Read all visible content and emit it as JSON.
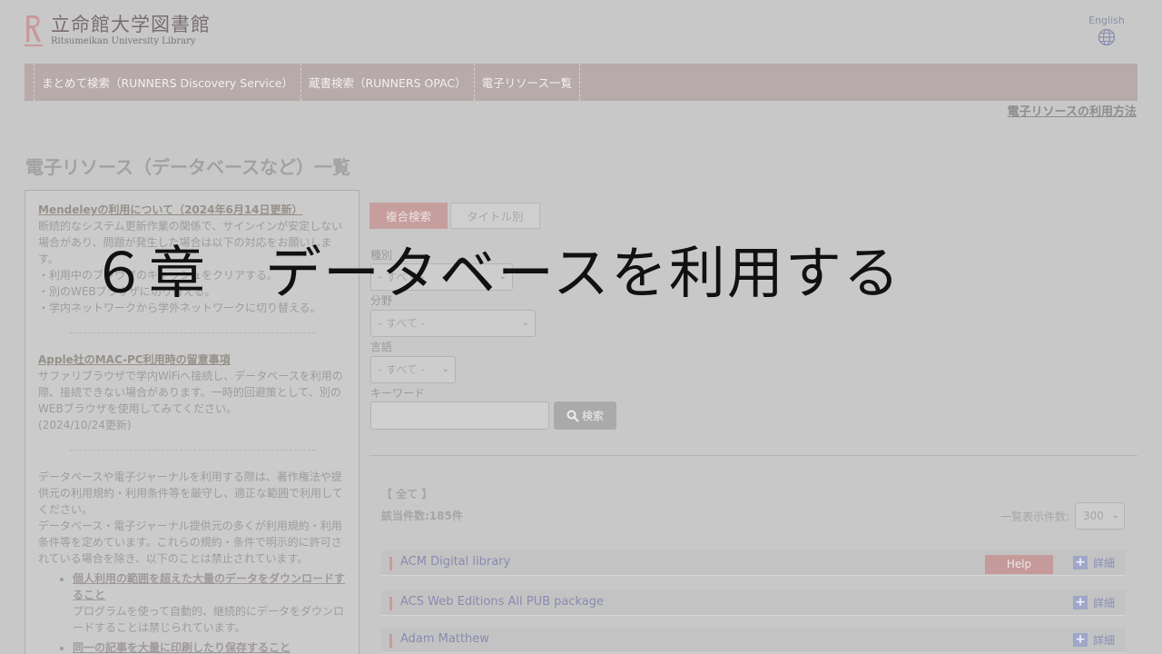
{
  "header": {
    "logo_jp": "立命館大学図書館",
    "logo_en": "Ritsumeikan University Library",
    "lang_label": "English"
  },
  "nav": {
    "items": [
      {
        "label": "まとめて検索（RUNNERS Discovery Service）"
      },
      {
        "label": "蔵書検索（RUNNERS OPAC）"
      },
      {
        "label": "電子リソース一覧"
      }
    ],
    "usage_link": "電子リソースの利用方法"
  },
  "page_title": "電子リソース（データベースなど）一覧",
  "notice": {
    "mendeley_link": "Mendeleyの利用について（2024年6月14日更新）",
    "mendeley_text": "断続的なシステム更新作業の関係で、サインインが安定しない場合があり、問題が発生した場合は以下の対応をお願いします。",
    "mendeley_items": [
      "・利用中のブラウザのキャッシュをクリアする。",
      "・別のWEBブラウザに切り替える。",
      "・学内ネットワークから学外ネットワークに切り替える。"
    ],
    "apple_link": "Apple社のMAC-PC利用時の留意事項",
    "apple_text": "サファリブラウザで学内WiFiへ接続し、データベースを利用の際、接続できない場合があります。一時的回避策として、別のWEBブラウザを使用してみてください。",
    "apple_date": "(2024/10/24更新)",
    "copyright_text_1": "データベースや電子ジャーナルを利用する際は、著作権法や提供元の利用規約・利用条件等を厳守し、適正な範囲で利用してください。",
    "copyright_text_2": "データベース・電子ジャーナル提供元の多くが利用規約・利用条件等を定めています。これらの規約・条件で明示的に許可されている場合を除き、以下のことは禁止されています。",
    "bullet_1_title": "個人利用の範囲を超えた大量のデータをダウンロードすること",
    "bullet_1_text": "プログラムを使って自動的、継続的にデータをダウンロードすることは禁じられています。",
    "bullet_2_title": "同一の記事を大量に印刷したり保存すること"
  },
  "search": {
    "tabs": [
      {
        "label": "複合検索"
      },
      {
        "label": "タイトル別"
      }
    ],
    "type_label": "種別",
    "type_value": "- すべて -",
    "field_label": "分野",
    "field_value": "- すべて -",
    "lang_label": "言語",
    "lang_value": "- すべて -",
    "keyword_label": "キーワード",
    "keyword_value": "",
    "search_button": "検索"
  },
  "results": {
    "category": "【 全て 】",
    "count": "該当件数:185件",
    "perpage_label": "一覧表示件数:",
    "perpage_value": "300",
    "items": [
      {
        "name": "ACM Digital library",
        "help": "Help",
        "detail": "詳細"
      },
      {
        "name": "ACS Web Editions All PUB package",
        "detail": "詳細"
      },
      {
        "name": "Adam Matthew",
        "detail": "詳細"
      }
    ]
  },
  "overlay_title": "６章　データベースを利用する",
  "colors": {
    "brand": "#c99a9a",
    "nav_bg": "#b7aaab",
    "link_blue": "#8a8bb0"
  }
}
